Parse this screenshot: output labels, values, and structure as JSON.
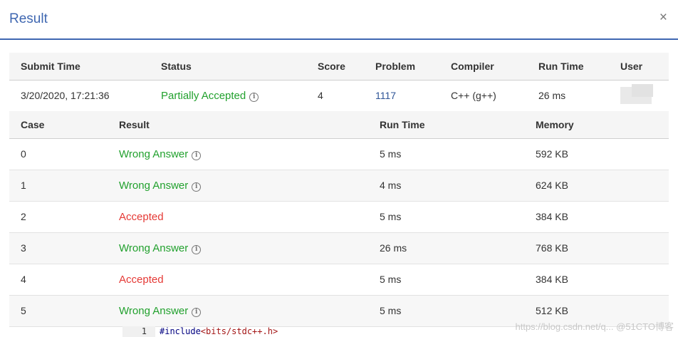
{
  "modal": {
    "title": "Result",
    "close_icon": "×"
  },
  "summary": {
    "headers": [
      "Submit Time",
      "Status",
      "Score",
      "Problem",
      "Compiler",
      "Run Time",
      "User"
    ],
    "row": {
      "submit_time": "3/20/2020, 17:21:36",
      "status": "Partially Accepted",
      "score": "4",
      "problem": "1117",
      "compiler": "C++ (g++)",
      "run_time": "26 ms"
    }
  },
  "cases": {
    "headers": [
      "Case",
      "Result",
      "Run Time",
      "Memory"
    ],
    "rows": [
      {
        "case": "0",
        "result": "Wrong Answer",
        "run_time": "5 ms",
        "memory": "592 KB"
      },
      {
        "case": "1",
        "result": "Wrong Answer",
        "run_time": "4 ms",
        "memory": "624 KB"
      },
      {
        "case": "2",
        "result": "Accepted",
        "run_time": "5 ms",
        "memory": "384 KB"
      },
      {
        "case": "3",
        "result": "Wrong Answer",
        "run_time": "26 ms",
        "memory": "768 KB"
      },
      {
        "case": "4",
        "result": "Accepted",
        "run_time": "5 ms",
        "memory": "384 KB"
      },
      {
        "case": "5",
        "result": "Wrong Answer",
        "run_time": "5 ms",
        "memory": "512 KB"
      }
    ]
  },
  "code": {
    "line_no": "1",
    "directive": "#include",
    "header": "<bits/stdc++.h>"
  },
  "watermark": "https://blog.csdn.net/q... @51CTO博客",
  "colors": {
    "accent": "#3f67b1",
    "wrong": "#22a12e",
    "accepted": "#e53935",
    "link": "#2f5597"
  },
  "icons": {
    "info": "info-circle-icon",
    "close": "close-icon"
  }
}
